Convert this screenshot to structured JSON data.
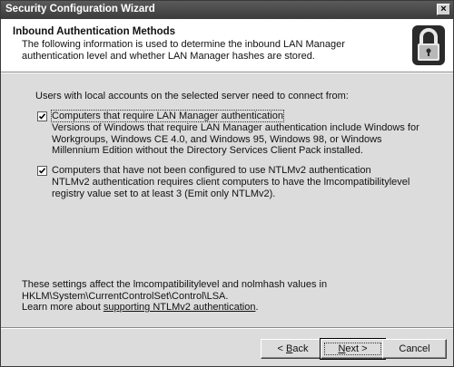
{
  "window": {
    "title": "Security Configuration Wizard",
    "close_glyph": "×"
  },
  "header": {
    "title": "Inbound Authentication Methods",
    "description": "The following information is used to determine the inbound LAN Manager authentication level and whether LAN Manager hashes are stored.",
    "icon": "lock-icon"
  },
  "main": {
    "prompt": "Users with local accounts on the selected server need to connect from:",
    "options": [
      {
        "label": "Computers that require LAN Manager authentication",
        "checked": true,
        "description": "Versions of Windows that require LAN Manager authentication include Windows for Workgroups, Windows CE 4.0, and Windows 95, Windows 98, or Windows Millennium Edition without the Directory Services Client Pack installed."
      },
      {
        "label": "Computers that have not been configured to use NTLMv2 authentication",
        "checked": true,
        "description": "NTLMv2 authentication requires client computers to have the lmcompatibilitylevel registry value set to at least 3 (Emit only NTLMv2)."
      }
    ],
    "footer_line1": "These settings affect the lmcompatibilitylevel and nolmhash values in",
    "footer_line2": "HKLM\\System\\CurrentControlSet\\Control\\LSA.",
    "learn_more_prefix": "Learn more about ",
    "learn_more_link": "supporting NTLMv2 authentication",
    "learn_more_suffix": "."
  },
  "buttons": {
    "back": {
      "accel": "B",
      "rest": "ack",
      "prefix": "< "
    },
    "next": {
      "accel": "N",
      "rest": "ext",
      "suffix": " >"
    },
    "cancel": "Cancel"
  }
}
